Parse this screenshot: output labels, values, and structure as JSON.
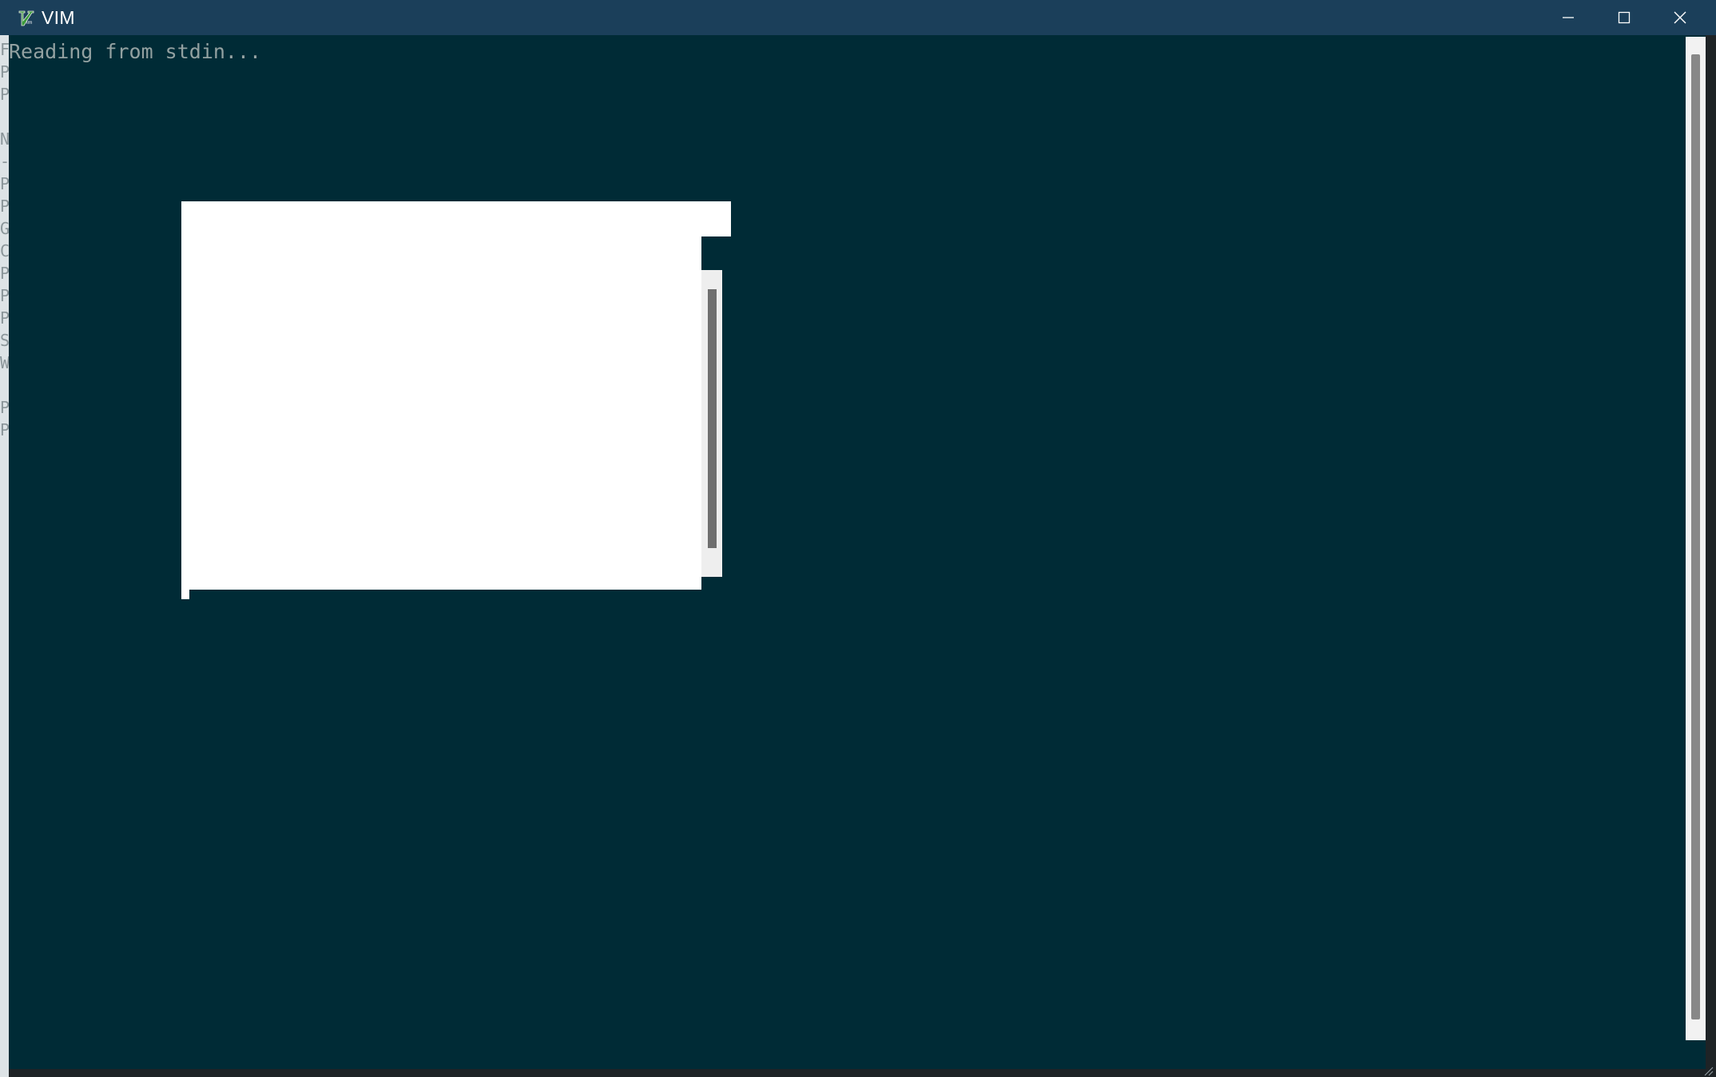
{
  "window": {
    "title": "VIM",
    "icon": "vim-logo-icon",
    "controls": {
      "minimize_icon": "minimize-icon",
      "maximize_icon": "maximize-icon",
      "close_icon": "close-icon"
    }
  },
  "editor": {
    "message": "Reading from stdin..."
  },
  "colors": {
    "titlebar": "#1b3f5a",
    "editor_background": "#002b36",
    "editor_text": "#93a1a1",
    "popup_background": "#ffffff",
    "scrollbar_track": "#f2f2f2",
    "scrollbar_thumb": "#888888"
  }
}
